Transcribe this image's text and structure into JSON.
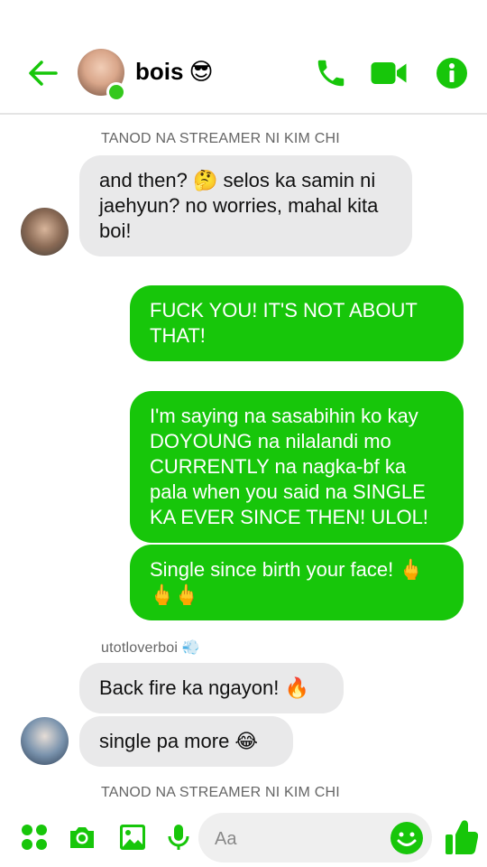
{
  "header": {
    "title": "bois",
    "title_emoji": "😎"
  },
  "messages": {
    "group1_sender": "TANOD NA STREAMER NI KIM CHI",
    "group1_msg1": "and then? 🤔 selos ka samin ni jaehyun? no worries, mahal kita boi!",
    "out_msg1": "FUCK YOU! IT'S  NOT ABOUT THAT!",
    "out_msg2": "I'm saying na sasabihin ko kay DOYOUNG na nilalandi mo CURRENTLY na nagka-bf ka pala when you said na SINGLE KA EVER SINCE THEN! ULOL!",
    "out_msg3": "Single since birth your face! 🖕🖕🖕",
    "group2_sender": "utotloverboi 💨",
    "group2_msg1": "Back fire ka ngayon! 🔥",
    "group2_msg2": "single pa more 😂",
    "group3_sender": "TANOD NA STREAMER NI KIM CHI"
  },
  "composer": {
    "placeholder": "Aa"
  },
  "colors": {
    "accent": "#17c60a",
    "incoming_bubble": "#e9e9ea",
    "online": "#34c81c"
  }
}
